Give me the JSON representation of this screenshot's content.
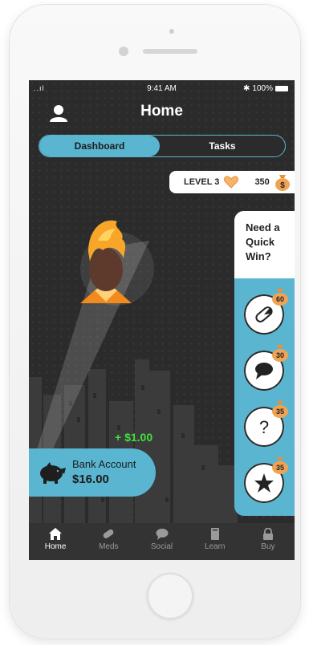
{
  "status_bar": {
    "signal": "..ıl",
    "time": "9:41 AM",
    "battery": "100%"
  },
  "header": {
    "title": "Home"
  },
  "tabs": [
    {
      "label": "Dashboard",
      "active": true
    },
    {
      "label": "Tasks",
      "active": false
    }
  ],
  "level_bar": {
    "level": "LEVEL 3",
    "coins": "350"
  },
  "quick_win": {
    "title_line1": "Need a",
    "title_line2": "Quick",
    "title_line3": "Win?",
    "items": [
      {
        "icon": "pill-icon",
        "value": "60"
      },
      {
        "icon": "chat-icon",
        "value": "30"
      },
      {
        "icon": "question-icon",
        "value": "35"
      },
      {
        "icon": "star-icon",
        "value": "35"
      }
    ]
  },
  "earned": "+ $1.00",
  "bank": {
    "label": "Bank Account",
    "amount": "$16.00"
  },
  "nav": [
    {
      "label": "Home",
      "icon": "home-icon",
      "active": true
    },
    {
      "label": "Meds",
      "icon": "pill-icon",
      "active": false
    },
    {
      "label": "Social",
      "icon": "chat-icon",
      "active": false
    },
    {
      "label": "Learn",
      "icon": "book-icon",
      "active": false
    },
    {
      "label": "Buy",
      "icon": "lock-icon",
      "active": false
    }
  ],
  "colors": {
    "accent": "#5ab5d0",
    "screen_bg": "#2b2b2b",
    "earned": "#3fe03f",
    "coin_bag": "#e8913a"
  }
}
